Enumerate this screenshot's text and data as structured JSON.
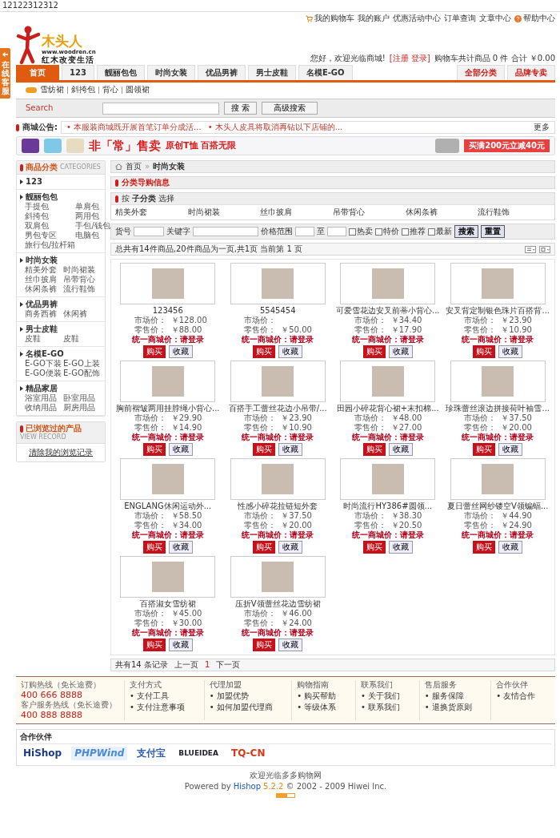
{
  "top_label": "12122312312",
  "side_tab": {
    "label": "在线客服"
  },
  "top_links": [
    {
      "label": "我的购物车",
      "kind": "cart"
    },
    {
      "label": "我的账户",
      "kind": "plain"
    },
    {
      "label": "优惠活动中心",
      "kind": "plain"
    },
    {
      "label": "订单查询",
      "kind": "plain"
    },
    {
      "label": "文章中心",
      "kind": "plain"
    },
    {
      "label": "帮助中心",
      "kind": "help"
    }
  ],
  "logo": {
    "name": "木头人",
    "url": "www.woodren.cn",
    "slogan": "红木改变生活"
  },
  "welcome": "您好，欢迎光临商城!",
  "auth": "[注册 登录]",
  "cart_summary": "购物车共计商品 0 件 合计 ￥0.00",
  "main_nav": [
    {
      "label": "首页",
      "selected": true
    },
    {
      "label": "123",
      "selected": false
    },
    {
      "label": "靓丽包包",
      "selected": false
    },
    {
      "label": "时尚女装",
      "selected": false
    },
    {
      "label": "优品男裤",
      "selected": false
    },
    {
      "label": "男士皮鞋",
      "selected": false
    },
    {
      "label": "名模E-GO",
      "selected": false
    }
  ],
  "right_nav": [
    "全部分类",
    "品牌专卖"
  ],
  "sub_nav": [
    "雪纺裙",
    "斜挎包",
    "背心",
    "圆领裙"
  ],
  "search": {
    "label": "Search",
    "button": "搜 索",
    "advanced": "高级搜索"
  },
  "notice": {
    "title": "商城公告:",
    "items": [
      "• 本服装商城既开展首笔订单分成活...",
      "• 木头人皮具将取消再钻以下店铺的..."
    ],
    "more": "更多"
  },
  "banner": {
    "headline": "非「常」售卖",
    "tagline": "原创T恤 百搭无限",
    "offer": "买满200元立减40元"
  },
  "sidebar": {
    "title": "商品分类",
    "subtitle": "CATEGORIES",
    "groups": [
      {
        "name": "123"
      },
      {
        "name": "靓丽包包",
        "items": [
          "手提包",
          "单肩包",
          "斜挎包",
          "两用包",
          "双肩包",
          "手包/钱包",
          "男包专区",
          "电脑包",
          "旅行包/拉杆箱"
        ]
      },
      {
        "name": "时尚女装",
        "items": [
          "精美外套",
          "时尚裙装",
          "丝巾披肩",
          "吊带背心",
          "休闲条裤",
          "流行鞋饰"
        ]
      },
      {
        "name": "优品男裤",
        "items": [
          "商务西裤",
          "休闲裤"
        ]
      },
      {
        "name": "男士皮鞋",
        "items": [
          "皮鞋",
          "皮鞋"
        ]
      },
      {
        "name": "名模E-GO",
        "items": [
          "E-GO下装",
          "E-GO上装",
          "E-GO便装",
          "E-GO配饰"
        ]
      },
      {
        "name": "精品家居",
        "items": [
          "浴室用品",
          "卧室用品",
          "收纳用品",
          "厨房用品"
        ]
      }
    ]
  },
  "history": {
    "title": "已浏览过的产品",
    "subtitle": "VIEW RECORD",
    "clear": "清除我的浏览记录"
  },
  "breadcrumb": [
    "首页",
    "»",
    "时尚女装"
  ],
  "guide_title": "分类导购信息",
  "subcategory": {
    "title": "按 **子分类** 选择",
    "items": [
      "精美外套",
      "时尚裙装",
      "丝巾披肩",
      "吊带背心",
      "休闲条裤",
      "流行鞋饰"
    ]
  },
  "filter": {
    "fields": [
      "货号",
      "关键字",
      "价格范围",
      "至"
    ],
    "checks": [
      {
        "label": "热卖",
        "checked": false
      },
      {
        "label": "特价",
        "checked": false
      },
      {
        "label": "推荐",
        "checked": false
      },
      {
        "label": "最新",
        "checked": false
      }
    ],
    "search": "搜索",
    "reset": "重置"
  },
  "summary": "总共有14件商品,20件商品为一页,共1页 当前第 1 页",
  "products": [
    {
      "name": "123456",
      "market_label": "市场价：",
      "market_price": "￥128.00",
      "retail_label": "零售价：",
      "retail_price": "￥88.00",
      "member_label": "统一商城价：",
      "member_price": "请登录",
      "buy": "购买",
      "fav": "收藏"
    },
    {
      "name": "5545454",
      "market_label": "市场价：",
      "retail_label": "零售价：",
      "retail_price": "￥50.00",
      "member_label": "统一商城价：",
      "member_price": "请登录",
      "buy": "购买",
      "fav": "收藏"
    },
    {
      "name": "可爱雪花边安叉前蒂小背心...",
      "market_label": "市场价：",
      "market_price": "￥34.40",
      "retail_label": "零售价：",
      "retail_price": "￥17.90",
      "member_label": "统一商城价：",
      "member_price": "请登录",
      "buy": "购买",
      "fav": "收藏"
    },
    {
      "name": "安叉背定制银色珠片百搭背...",
      "market_label": "市场价：",
      "market_price": "￥23.90",
      "retail_label": "零售价：",
      "retail_price": "￥10.90",
      "member_label": "统一商城价：",
      "member_price": "请登录",
      "buy": "购买",
      "fav": "收藏"
    },
    {
      "name": "胸前褶皱两用挂脖绳小背心...",
      "market_label": "市场价：",
      "market_price": "￥29.90",
      "retail_label": "零售价：",
      "retail_price": "￥14.90",
      "member_label": "统一商城价：",
      "member_price": "请登录",
      "buy": "购买",
      "fav": "收藏"
    },
    {
      "name": "百搭手工蕾丝花边小吊带/...",
      "market_label": "市场价：",
      "market_price": "￥23.90",
      "retail_label": "零售价：",
      "retail_price": "￥10.90",
      "member_label": "统一商城价：",
      "member_price": "请登录",
      "buy": "购买",
      "fav": "收藏"
    },
    {
      "name": "田园小碎花背心裙+末扣棉...",
      "market_label": "市场价：",
      "market_price": "￥48.00",
      "retail_label": "零售价：",
      "retail_price": "￥27.00",
      "member_label": "统一商城价：",
      "member_price": "请登录",
      "buy": "购买",
      "fav": "收藏"
    },
    {
      "name": "珍珠蕾丝滚边拼接荷叶袖雪...",
      "market_label": "市场价：",
      "market_price": "￥37.50",
      "retail_label": "零售价：",
      "retail_price": "￥20.00",
      "member_label": "统一商城价：",
      "member_price": "请登录",
      "buy": "购买",
      "fav": "收藏"
    },
    {
      "name": "ENGLANG休闲运动外...",
      "market_label": "市场价：",
      "market_price": "￥58.50",
      "retail_label": "零售价：",
      "retail_price": "￥34.00",
      "member_label": "统一商城价：",
      "member_price": "请登录",
      "buy": "购买",
      "fav": "收藏"
    },
    {
      "name": "性感小碎花拉链短外套",
      "market_label": "市场价：",
      "market_price": "￥37.50",
      "retail_label": "零售价：",
      "retail_price": "￥20.00",
      "member_label": "统一商城价：",
      "member_price": "请登录",
      "buy": "购买",
      "fav": "收藏"
    },
    {
      "name": "时尚流行HY386#圆领...",
      "market_label": "市场价：",
      "market_price": "￥38.30",
      "retail_label": "零售价：",
      "retail_price": "￥20.50",
      "member_label": "统一商城价：",
      "member_price": "请登录",
      "buy": "购买",
      "fav": "收藏"
    },
    {
      "name": "夏日蕾丝网纱镂空V领蝙蝠...",
      "market_label": "市场价：",
      "market_price": "￥44.90",
      "retail_label": "零售价：",
      "retail_price": "￥24.90",
      "member_label": "统一商城价：",
      "member_price": "请登录",
      "buy": "购买",
      "fav": "收藏"
    },
    {
      "name": "百搭淑女雪纺裙",
      "market_label": "市场价：",
      "market_price": "￥45.00",
      "retail_label": "零售价：",
      "retail_price": "￥30.00",
      "member_label": "统一商城价：",
      "member_price": "请登录",
      "buy": "购买",
      "fav": "收藏"
    },
    {
      "name": "压折V领蕾丝花边雪纺裙",
      "market_label": "市场价：",
      "market_price": "￥46.00",
      "retail_label": "零售价：",
      "retail_price": "￥24.00",
      "member_label": "统一商城价：",
      "member_price": "请登录",
      "buy": "购买",
      "fav": "收藏"
    }
  ],
  "pagination": {
    "total": "共有14 条记录",
    "prev": "上一页",
    "current": "1",
    "next": "下一页"
  },
  "footer": {
    "hotlines": [
      {
        "label": "订购热线（免长途费）",
        "number": "400 666 8888"
      },
      {
        "label": "客户服务热线（免长途费）",
        "number": "400 888 8888"
      }
    ],
    "columns": [
      {
        "title": "支付方式",
        "links": [
          "• 支付工具",
          "• 支付注意事项"
        ]
      },
      {
        "title": "代理加盟",
        "links": [
          "• 加盟优势",
          "• 如何加盟代理商"
        ]
      },
      {
        "title": "购物指南",
        "links": [
          "• 购买帮助",
          "• 等级体系"
        ]
      },
      {
        "title": "联系我们",
        "links": [
          "• 关于我们",
          "• 联系我们"
        ]
      },
      {
        "title": "售后服务",
        "links": [
          "• 服务保障",
          "• 退换货原则"
        ]
      },
      {
        "title": "合作伙伴",
        "links": [
          "• 友情合作"
        ]
      }
    ]
  },
  "partners": {
    "title": "合作伙伴",
    "logos": [
      "HiShop",
      "PHPWind",
      "支付宝",
      "BLUEIDEA",
      "TQ-CN"
    ]
  },
  "bottom": {
    "welcome": "欢迎光临多多购物网",
    "powered": "Powered by",
    "brand": "Hishop",
    "version": "5.2.2",
    "copyright": "© 2002 - 2009 Hiwei Inc."
  }
}
